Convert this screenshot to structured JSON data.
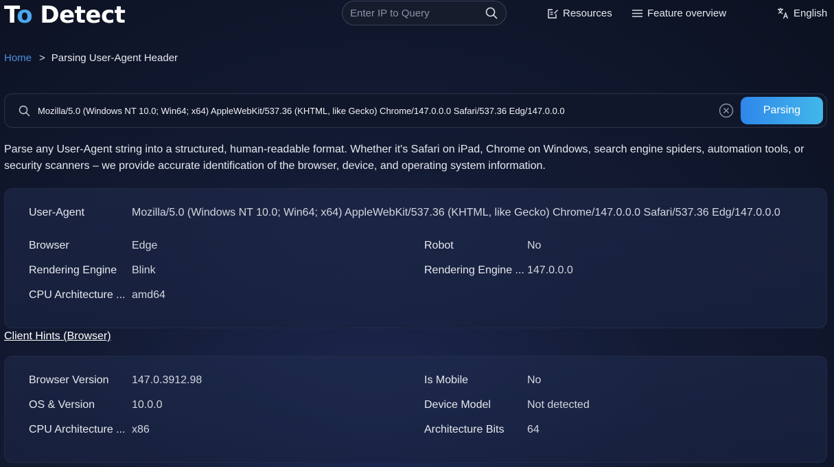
{
  "logo": {
    "text_prefix": "T",
    "text_accent": "o",
    "text_suffix": " Detect"
  },
  "header": {
    "ip_search_placeholder": "Enter IP to Query",
    "resources_label": "Resources",
    "features_label": "Feature overview",
    "language_label": "English"
  },
  "breadcrumb": {
    "home": "Home",
    "separator": ">",
    "current": "Parsing User-Agent Header"
  },
  "ua_input": {
    "value": "Mozilla/5.0 (Windows NT 10.0; Win64; x64) AppleWebKit/537.36 (KHTML, like Gecko) Chrome/147.0.0.0 Safari/537.36 Edg/147.0.0.0",
    "button_label": "Parsing"
  },
  "description": "Parse any User-Agent string into a structured, human-readable format. Whether it's Safari on iPad, Chrome on Windows, search engine spiders, automation tools, or security scanners – we provide accurate identification of the browser, device, and operating system information.",
  "result": {
    "user_agent_label": "User-Agent",
    "user_agent_value": "Mozilla/5.0 (Windows NT 10.0; Win64; x64) AppleWebKit/537.36 (KHTML, like Gecko) Chrome/147.0.0.0 Safari/537.36 Edg/147.0.0.0",
    "browser_label": "Browser",
    "browser_value": "Edge",
    "robot_label": "Robot",
    "robot_value": "No",
    "engine_label": "Rendering Engine",
    "engine_value": "Blink",
    "engine_version_label": "Rendering Engine ...",
    "engine_version_value": "147.0.0.0",
    "cpu_label": "CPU Architecture ...",
    "cpu_value": "amd64"
  },
  "client_hints": {
    "link_label": "Client Hints (Browser)",
    "browser_version_label": "Browser Version",
    "browser_version_value": "147.0.3912.98",
    "is_mobile_label": "Is Mobile",
    "is_mobile_value": "No",
    "os_label": "OS & Version",
    "os_value": "10.0.0",
    "device_model_label": "Device Model",
    "device_model_value": "Not detected",
    "cpu_label": "CPU Architecture ...",
    "cpu_value": "x86",
    "arch_bits_label": "Architecture Bits",
    "arch_bits_value": "64"
  },
  "colors": {
    "accent_link": "#4d8fe0",
    "button_gradient_start": "#2f86ea",
    "button_gradient_end": "#42b8ea",
    "background": "#0c1120"
  },
  "icons": {
    "search": "search-icon",
    "resources": "edit-note-icon",
    "features": "menu-icon",
    "language": "translate-icon",
    "clear": "clear-icon"
  }
}
